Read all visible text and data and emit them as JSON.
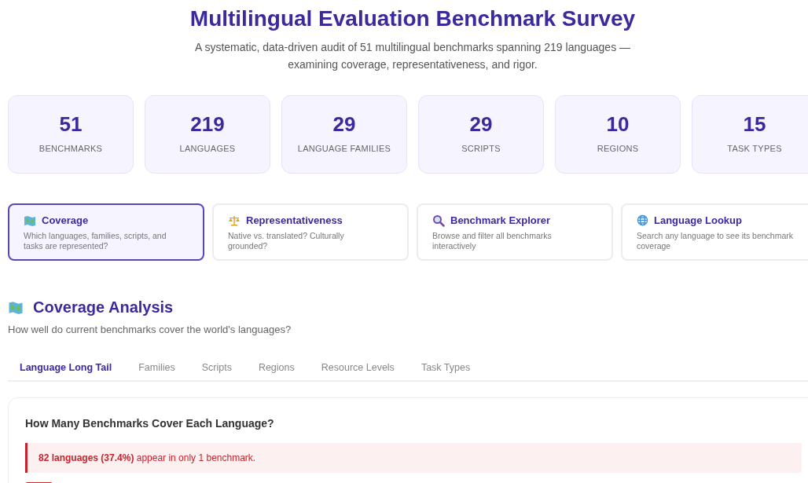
{
  "header": {
    "title": "Multilingual Evaluation Benchmark Survey",
    "subtitle": "A systematic, data-driven audit of 51 multilingual benchmarks spanning 219 languages — examining coverage, representativeness, and rigor."
  },
  "stats": [
    {
      "value": "51",
      "label": "BENCHMARKS"
    },
    {
      "value": "219",
      "label": "LANGUAGES"
    },
    {
      "value": "29",
      "label": "LANGUAGE FAMILIES"
    },
    {
      "value": "29",
      "label": "SCRIPTS"
    },
    {
      "value": "10",
      "label": "REGIONS"
    },
    {
      "value": "15",
      "label": "TASK TYPES"
    }
  ],
  "sections": [
    {
      "kind": "map",
      "title": "Coverage",
      "description": "Which languages, families, scripts, and tasks are represented?",
      "selected": true
    },
    {
      "kind": "scales",
      "title": "Representativeness",
      "description": "Native vs. translated? Culturally grounded?",
      "selected": false
    },
    {
      "kind": "magnifier",
      "title": "Benchmark Explorer",
      "description": "Browse and filter all benchmarks interactively",
      "selected": false
    },
    {
      "kind": "globe",
      "title": "Language Lookup",
      "description": "Search any language to see its benchmark coverage",
      "selected": false
    }
  ],
  "analysis": {
    "title": "Coverage Analysis",
    "subtitle": "How well do current benchmarks cover the world's languages?",
    "tabs": [
      {
        "label": "Language Long Tail",
        "selected": true
      },
      {
        "label": "Families",
        "selected": false
      },
      {
        "label": "Scripts",
        "selected": false
      },
      {
        "label": "Regions",
        "selected": false
      },
      {
        "label": "Resource Levels",
        "selected": false
      },
      {
        "label": "Task Types",
        "selected": false
      }
    ],
    "card": {
      "title": "How Many Benchmarks Cover Each Language?",
      "alert": "**82 languages (37.4%)** appear in only 1 benchmark."
    }
  }
}
